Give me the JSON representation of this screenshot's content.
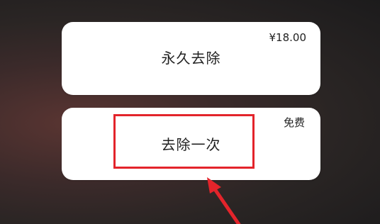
{
  "options": {
    "permanent": {
      "price": "¥18.00",
      "label": "永久去除"
    },
    "once": {
      "price": "免费",
      "label": "去除一次"
    }
  },
  "annotation": {
    "highlight_color": "#e3242b",
    "arrow_color": "#e3242b",
    "arrow_icon": "red-arrow-icon"
  }
}
